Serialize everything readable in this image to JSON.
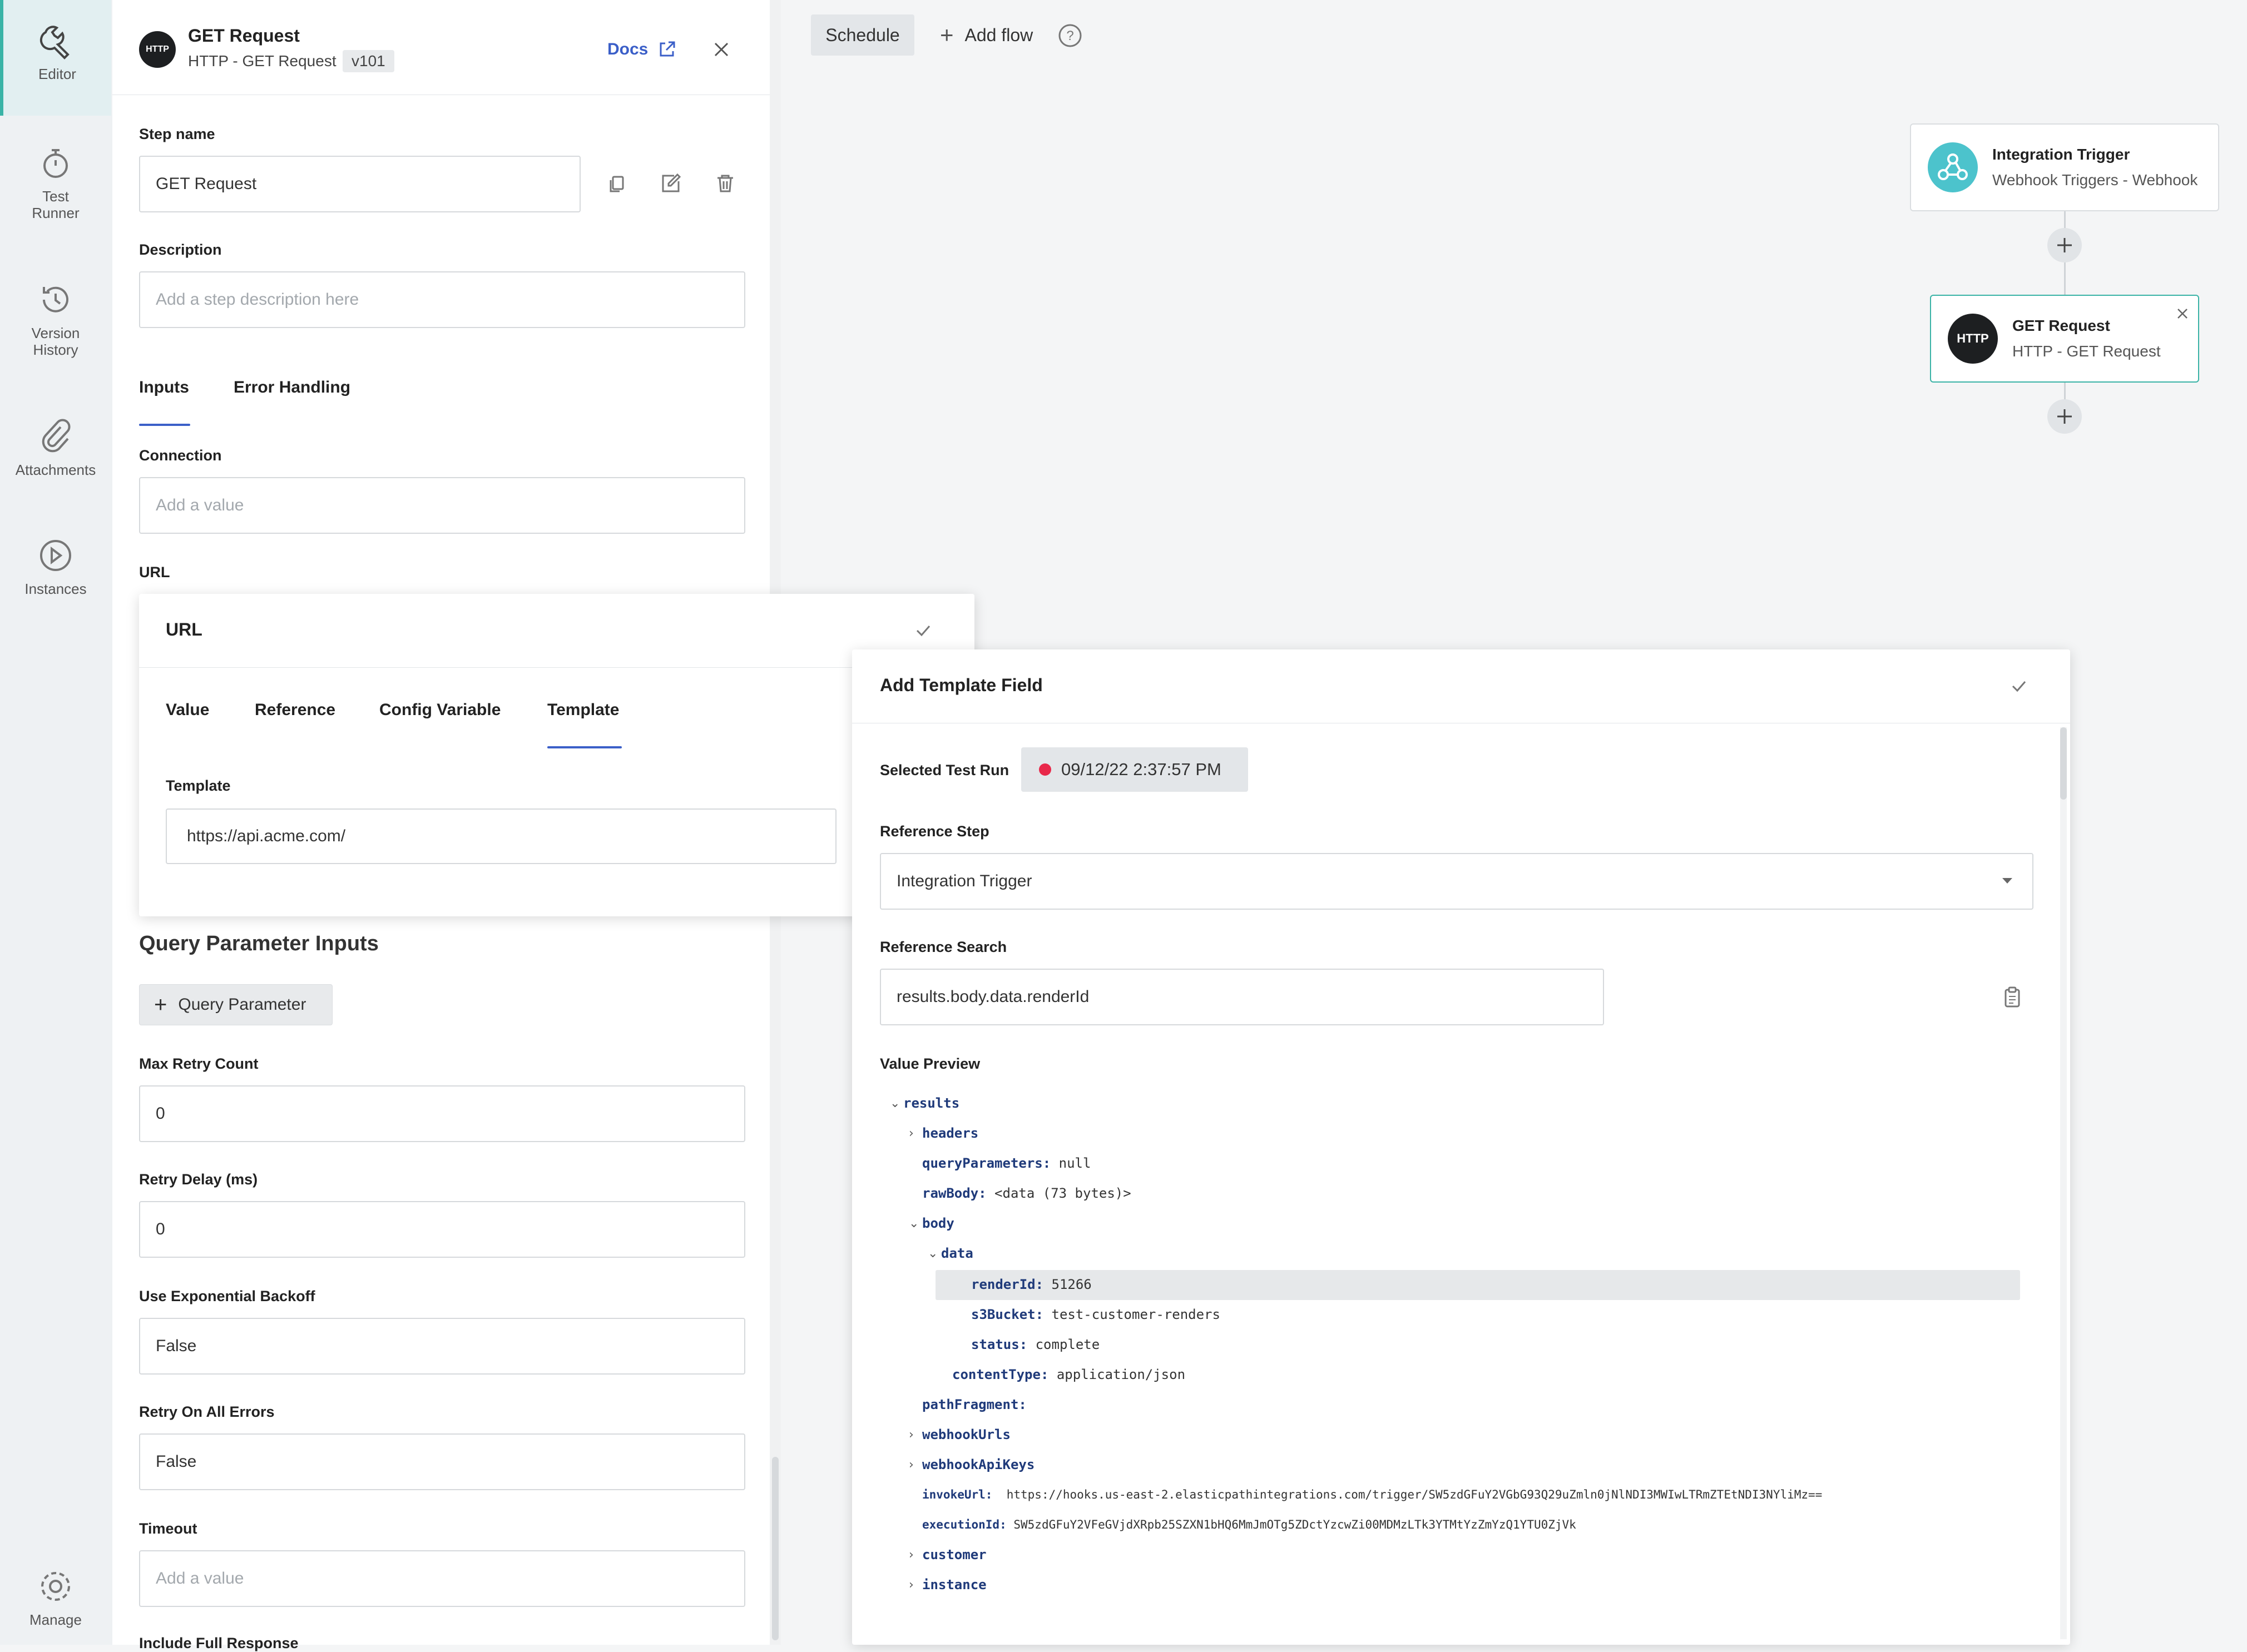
{
  "rail": {
    "items": [
      {
        "label_1": "Editor",
        "label_2": ""
      },
      {
        "label_1": "Test",
        "label_2": "Runner"
      },
      {
        "label_1": "Version",
        "label_2": "History"
      },
      {
        "label_1": "Attachments",
        "label_2": ""
      },
      {
        "label_1": "Instances",
        "label_2": ""
      }
    ],
    "manage": "Manage"
  },
  "panel": {
    "badge": "HTTP",
    "title": "GET Request",
    "subtitle": "HTTP - GET Request",
    "version": "v101",
    "docs": "Docs",
    "step_name_label": "Step name",
    "step_name_value": "GET Request",
    "description_label": "Description",
    "description_placeholder": "Add a step description here",
    "tabs": [
      "Inputs",
      "Error Handling"
    ],
    "connection_label": "Connection",
    "connection_placeholder": "Add a value",
    "url_label": "URL",
    "query_title": "Query Parameter Inputs",
    "query_button": "Query Parameter",
    "max_retry_label": "Max Retry Count",
    "max_retry_value": "0",
    "retry_delay_label": "Retry Delay (ms)",
    "retry_delay_value": "0",
    "exp_backoff_label": "Use Exponential Backoff",
    "exp_backoff_value": "False",
    "retry_all_label": "Retry On All Errors",
    "retry_all_value": "False",
    "timeout_label": "Timeout",
    "timeout_placeholder": "Add a value",
    "include_full_label": "Include Full Response"
  },
  "canvas": {
    "schedule": "Schedule",
    "add_flow": "Add flow",
    "trigger_title": "Integration Trigger",
    "trigger_subtitle": "Webhook Triggers - Webhook",
    "get_badge": "HTTP",
    "get_title": "GET Request",
    "get_subtitle": "HTTP - GET Request"
  },
  "url_popover": {
    "title": "URL",
    "tabs": [
      "Value",
      "Reference",
      "Config Variable",
      "Template"
    ],
    "template_label": "Template",
    "template_value": "https://api.acme.com/"
  },
  "template_popover": {
    "title": "Add Template Field",
    "selected_run_label": "Selected Test Run",
    "selected_run_value": "09/12/22 2:37:57 PM",
    "status_color": "#e8284a",
    "ref_step_label": "Reference Step",
    "ref_step_value": "Integration Trigger",
    "ref_search_label": "Reference Search",
    "ref_search_value": "results.body.data.renderId",
    "value_preview_label": "Value Preview",
    "tree": [
      {
        "chev": "⌄",
        "key": "results",
        "value": ""
      },
      {
        "chev": "›",
        "key": "headers",
        "value": ""
      },
      {
        "chev": "",
        "key": "queryParameters:",
        "value": "null"
      },
      {
        "chev": "",
        "key": "rawBody:",
        "value": "<data (73 bytes)>"
      },
      {
        "chev": "⌄",
        "key": "body",
        "value": ""
      },
      {
        "chev": "⌄",
        "key": "data",
        "value": ""
      },
      {
        "chev": "",
        "key": "renderId:",
        "value": "51266"
      },
      {
        "chev": "",
        "key": "s3Bucket:",
        "value": "test-customer-renders"
      },
      {
        "chev": "",
        "key": "status:",
        "value": "complete"
      },
      {
        "chev": "",
        "key": "contentType:",
        "value": "application/json"
      },
      {
        "chev": "",
        "key": "pathFragment:",
        "value": ""
      },
      {
        "chev": "›",
        "key": "webhookUrls",
        "value": ""
      },
      {
        "chev": "›",
        "key": "webhookApiKeys",
        "value": ""
      },
      {
        "chev": "",
        "key": "invokeUrl:",
        "value": "https://hooks.us-east-2.elasticpathintegrations.com/trigger/SW5zdGFuY2VGbG93Q29uZmln0jNlNDI3MWIwLTRmZTEtNDI3NYliMz=="
      },
      {
        "chev": "",
        "key": "executionId:",
        "value": "SW5zdGFuY2VFeGVjdXRpb25SZXN1bHQ6MmJmOTg5ZDctYzcwZi00MDMzLTk3YTMtYzZmYzQ1YTU0ZjVk"
      },
      {
        "chev": "›",
        "key": "customer",
        "value": ""
      },
      {
        "chev": "›",
        "key": "instance",
        "value": ""
      }
    ]
  },
  "colors": {
    "accent": "#3b5fc8",
    "teal": "#3ab3a6",
    "webhook_icon_bg": "#4cc3cc"
  }
}
